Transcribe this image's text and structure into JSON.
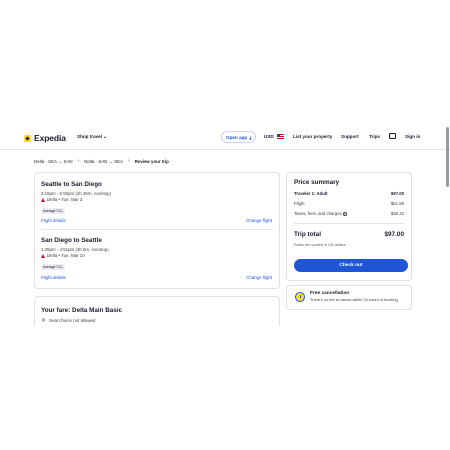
{
  "header": {
    "logo_text": "Expedia",
    "shop_travel": "Shop travel",
    "open_app": "Open app",
    "currency": "USD",
    "list_property": "List your property",
    "support": "Support",
    "trips": "Trips",
    "sign_in": "Sign in"
  },
  "breadcrumb": {
    "items": [
      "Delta · SEA → SAN",
      "Delta · SAN → SEA",
      "Review your trip"
    ]
  },
  "flights": [
    {
      "title": "Seattle to San Diego",
      "time": "3:15pm - 5:50pm (2h 35m, nonstop)",
      "airline_date": "Delta • Tue, Mar 3",
      "badge": "Average CO₂",
      "details_link": "Flight details",
      "change_link": "Change flight"
    },
    {
      "title": "San Diego to Seattle",
      "time": "1:45pm - 4:51pm (3h 6m, nonstop)",
      "airline_date": "Delta • Tue, Mar 10",
      "badge": "Average CO₂",
      "details_link": "Flight details",
      "change_link": "Change flight"
    }
  ],
  "fare": {
    "title": "Your fare: Delta Main Basic",
    "item": "Seat choice not allowed"
  },
  "price_summary": {
    "title": "Price summary",
    "traveler_label": "Traveler 1: Adult",
    "traveler_value": "$97.00",
    "flight_label": "Flight",
    "flight_value": "$61.58",
    "taxes_label": "Taxes, fees, and charges",
    "taxes_value": "$35.42",
    "total_label": "Trip total",
    "total_value": "$97.00",
    "note": "Rates are quoted in US dollars",
    "checkout": "Check out"
  },
  "cancellation": {
    "title": "Free cancellation",
    "text": "There's no fee to cancel within 24 hours of booking"
  }
}
